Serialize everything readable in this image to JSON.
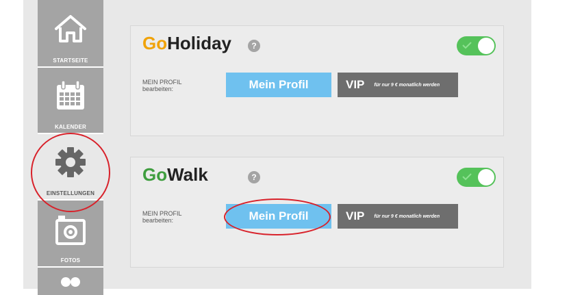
{
  "sidebar": {
    "items": [
      {
        "label": "STARTSEITE",
        "icon": "home-icon"
      },
      {
        "label": "KALENDER",
        "icon": "calendar-icon"
      },
      {
        "label": "EINSTELLUNGEN",
        "icon": "gear-icon",
        "active": true
      },
      {
        "label": "FOTOS",
        "icon": "camera-icon"
      },
      {
        "label": "",
        "icon": "group-icon"
      }
    ]
  },
  "cards": [
    {
      "brand_go": "Go",
      "brand_rest": "Holiday",
      "help": "?",
      "toggle_on": true,
      "profile_label_line1": "MEIN PROFIL",
      "profile_label_line2": "bearbeiten:",
      "profile_button": "Mein Profil",
      "vip_button": "VIP",
      "vip_note": "für nur 9 € monatlich werden"
    },
    {
      "brand_go": "Go",
      "brand_rest": "Walk",
      "help": "?",
      "toggle_on": true,
      "profile_label_line1": "MEIN PROFIL",
      "profile_label_line2": "bearbeiten:",
      "profile_button": "Mein Profil",
      "vip_button": "VIP",
      "vip_note": "für nur 9 € monatlich werden"
    }
  ],
  "colors": {
    "go_holiday": "#f0a30a",
    "go_walk": "#3f9e3f",
    "profile_button": "#6fc1ef",
    "vip_button": "#6e6e6e",
    "toggle_on": "#55c25a",
    "annotation": "#d8212a"
  }
}
